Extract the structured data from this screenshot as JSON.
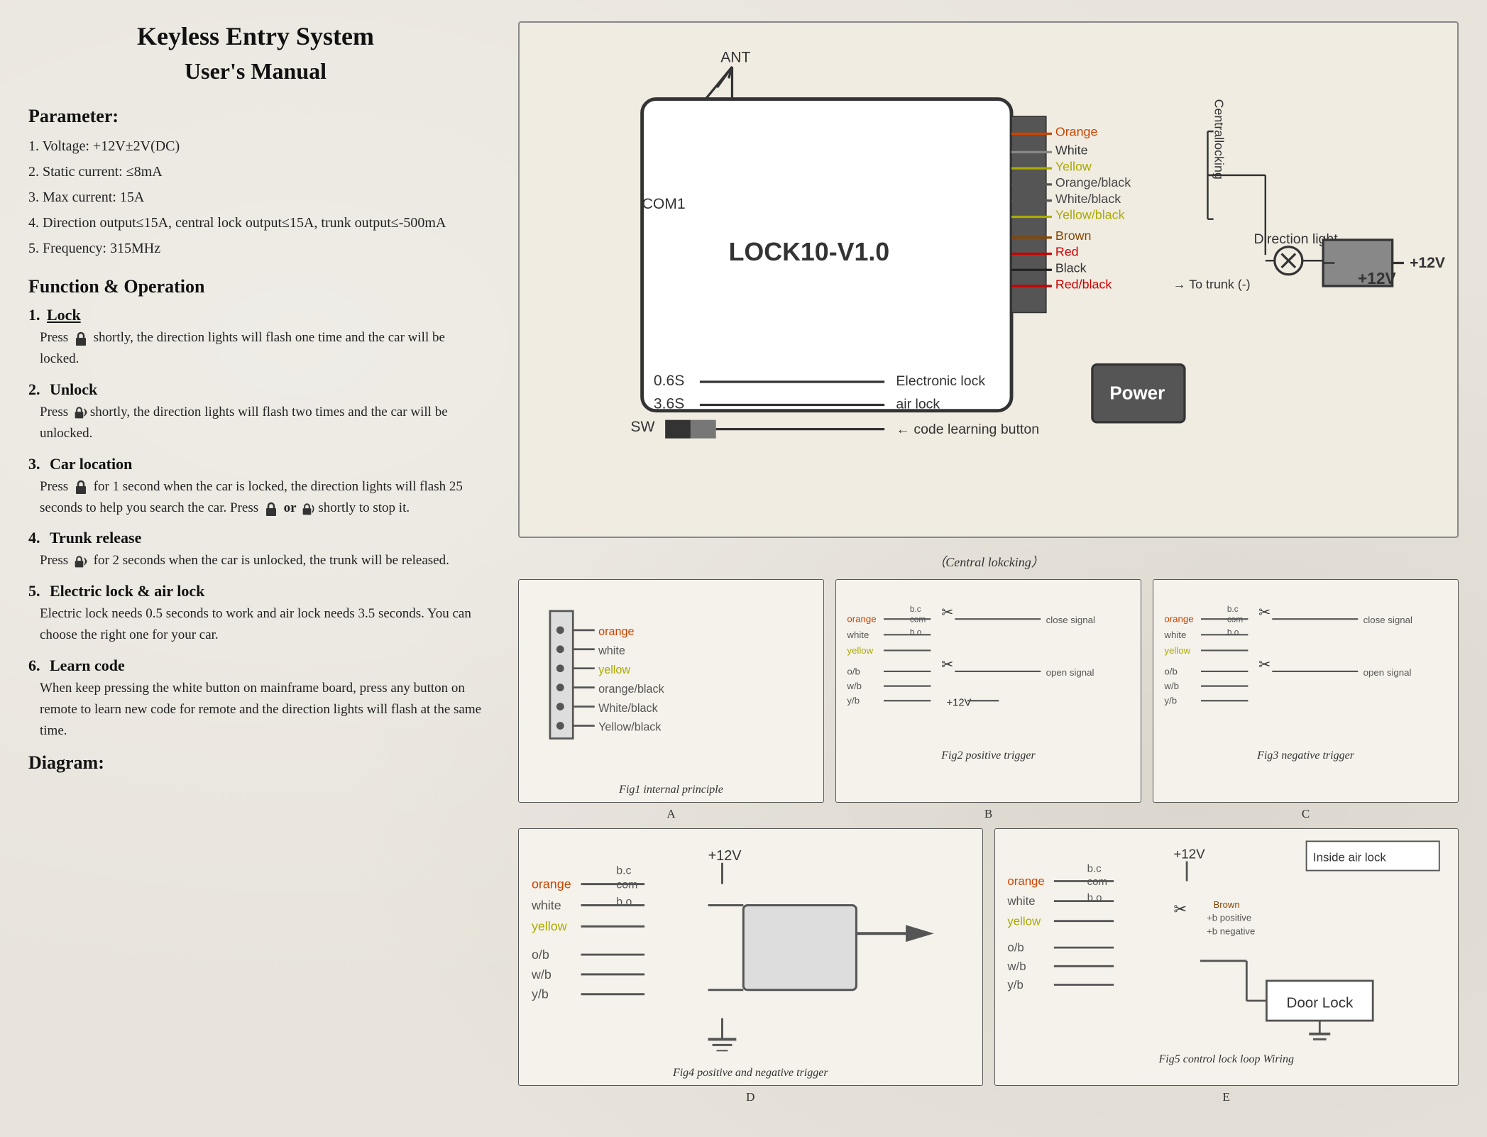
{
  "header": {
    "title": "Keyless Entry System",
    "subtitle": "User's Manual"
  },
  "parameter": {
    "section_title": "Parameter:",
    "items": [
      "1. Voltage: +12V±2V(DC)",
      "2. Static current: ≤8mA",
      "3. Max current: 15A",
      "4. Direction output≤15A, central lock output≤15A, trunk output≤-500mA",
      "5. Frequency: 315MHz"
    ]
  },
  "function": {
    "section_title": "Function & Operation",
    "items": [
      {
        "num": "1.",
        "title": "Lock",
        "body": "Press  shortly, the direction lights will flash one time and the car will be locked."
      },
      {
        "num": "2.",
        "title": "Unlock",
        "body": "Press  shortly, the direction lights will flash two times and the car will be unlocked."
      },
      {
        "num": "3.",
        "title": "Car location",
        "body": "Press  for 1 second when the car is locked, the direction lights will flash 25 seconds to help you search the car. Press  or  shortly to stop it."
      },
      {
        "num": "4.",
        "title": "Trunk release",
        "body": "Press   for 2 seconds when the car is unlocked, the trunk will be released."
      },
      {
        "num": "5.",
        "title": "Electric lock & air lock",
        "body": "Electric lock needs 0.5 seconds to work and air lock needs 3.5 seconds. You can choose the right one for your car."
      },
      {
        "num": "6.",
        "title": "Learn code",
        "body": "When keep pressing the white button on mainframe board, press any button on remote to learn new code for remote and the direction lights will flash at the same time."
      }
    ]
  },
  "diagram_title": "Diagram:",
  "central_locking_label": "（Central lokcking）",
  "fig_labels": [
    "Fig1 internal principle",
    "Fig2 positive trigger",
    "Fig3 negative trigger",
    "Fig4 positive and negative trigger",
    "Fig5 control lock loop Wiring"
  ],
  "fig_letters": [
    "A",
    "B",
    "C",
    "D",
    "E"
  ]
}
